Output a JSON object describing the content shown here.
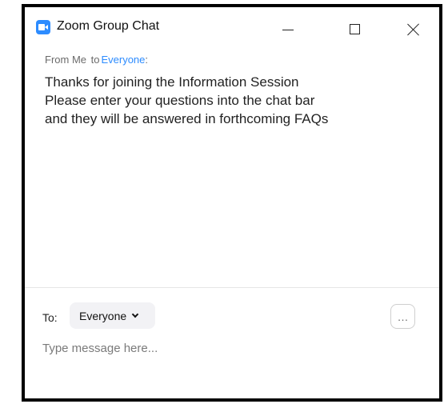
{
  "window": {
    "title": "Zoom Group Chat",
    "controls": {
      "minimize_icon": "minimize-icon",
      "maximize_icon": "maximize-icon",
      "close_icon": "close-icon"
    }
  },
  "messages": [
    {
      "from": "From Me",
      "to_word": "to",
      "to": "Everyone",
      "suffix": ":",
      "lines": [
        "Thanks for joining the Information Session",
        "Please enter your questions into the chat bar",
        "and they will be answered in forthcoming FAQs"
      ]
    }
  ],
  "compose": {
    "to_label": "To:",
    "recipient": "Everyone",
    "more_label": "…",
    "placeholder": "Type message here..."
  },
  "colors": {
    "accent": "#2d8cff",
    "frame": "#000000"
  }
}
